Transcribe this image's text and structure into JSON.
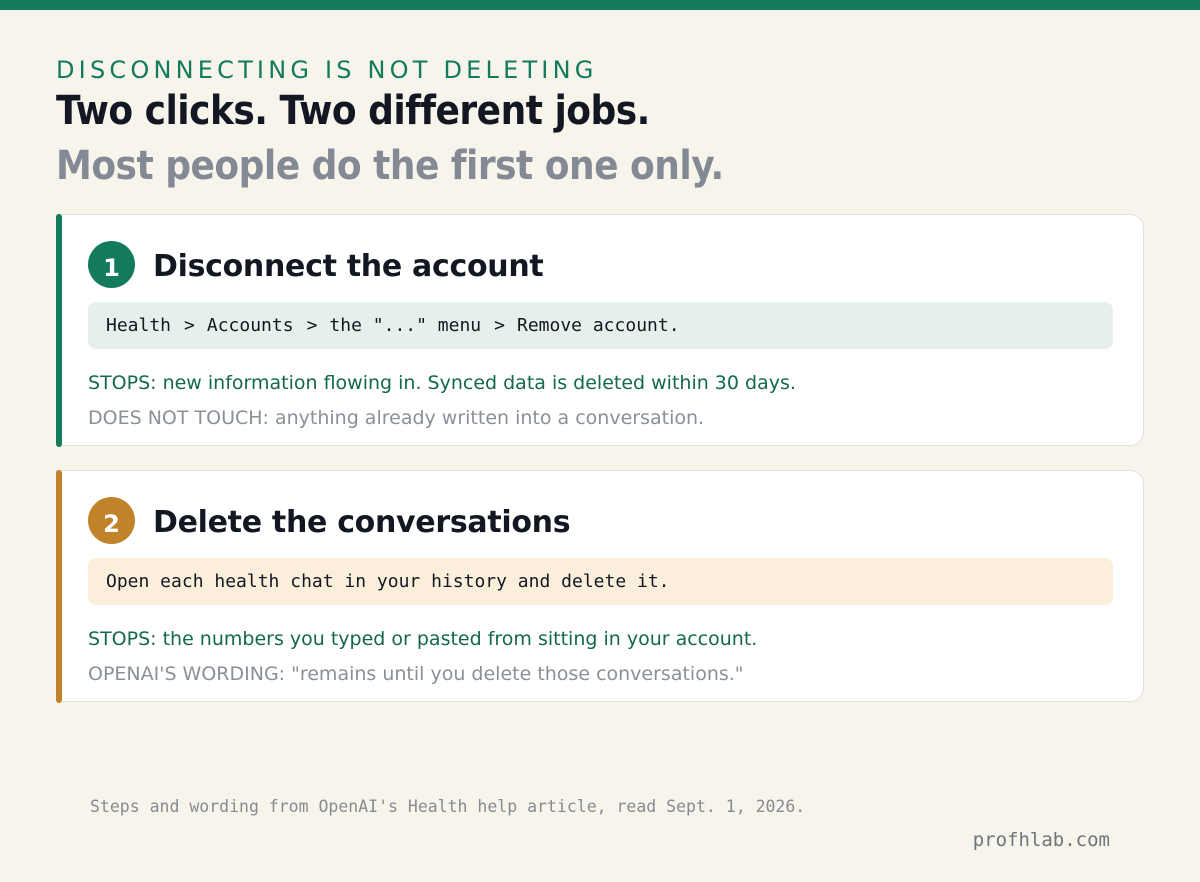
{
  "colors": {
    "accent_green": "#137b5c",
    "accent_amber": "#c0832a",
    "background": "#f7f4ec",
    "headline": "#121722",
    "subhead_gray": "#838a94"
  },
  "header": {
    "kicker": "DISCONNECTING IS NOT DELETING",
    "headline": "Two clicks. Two different jobs.",
    "subhead": "Most people do the first one only."
  },
  "steps": [
    {
      "number": "1",
      "title": "Disconnect the account",
      "path": [
        "Health",
        "Accounts",
        "the \"...\" menu",
        "Remove account."
      ],
      "separator": ">",
      "stops": "STOPS: new information flowing in. Synced data is deleted within 30 days.",
      "note": "DOES NOT TOUCH: anything already written into a conversation."
    },
    {
      "number": "2",
      "title": "Delete the conversations",
      "instruction": "Open each health chat in your history and delete it.",
      "stops": "STOPS: the numbers you typed or pasted from sitting in your account.",
      "note": "OPENAI'S WORDING: \"remains until you delete those conversations.\""
    }
  ],
  "footer": {
    "source": "Steps and wording from OpenAI's Health help article, read Sept. 1, 2026.",
    "site": "profhlab.com"
  }
}
